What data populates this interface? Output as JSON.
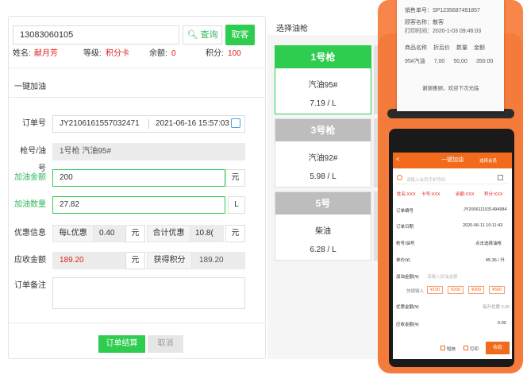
{
  "left": {
    "phone": "13083060105",
    "query_label": "查询",
    "cancel_label": "取客",
    "name_label": "姓名:",
    "name_value": "献月芳",
    "level_label": "等级:",
    "level_value": "积分卡",
    "balance_label": "余额:",
    "balance_value": "0",
    "points_label": "积分:",
    "points_value": "100",
    "section_title": "一键加油",
    "order_label": "订单号",
    "order_value": "JY2106161557032471",
    "order_time": "2021-06-16 15:57:03",
    "nozzle_label": "枪号/油号",
    "nozzle_value": "1号枪  汽油95#",
    "amount_label": "加油金额",
    "amount_value": "200",
    "amount_unit": "元",
    "qty_label": "加油数量",
    "qty_value": "27.82",
    "qty_unit": "L",
    "discount_label": "优惠信息",
    "per_l_label": "每L优惠",
    "per_l_value": "0.40",
    "per_l_unit": "元",
    "total_disc_label": "合计优惠",
    "total_disc_value": "10.8(",
    "total_disc_unit": "元",
    "receivable_label": "应收金额",
    "receivable_value": "189.20",
    "receivable_unit": "元",
    "earn_points_label": "获得积分",
    "earn_points_value": "189.20",
    "remark_label": "订单备注",
    "settle_label": "订单结算",
    "cancel2_label": "取消"
  },
  "mid": {
    "title": "选择油枪",
    "nozzles": [
      {
        "name": "1号枪",
        "fuel": "汽油95#",
        "price": "7.19 / L"
      },
      {
        "name": "3号枪",
        "fuel": "汽油92#",
        "price": "5.98 / L"
      },
      {
        "name": "5号",
        "fuel": "柴油",
        "price": "6.28 / L"
      }
    ]
  },
  "receipt": {
    "line1": "销售单号：SP1235687491857",
    "line2": "顾客名称：散客",
    "line3": "打印时间：2020-1-03  09:46:03",
    "header": [
      "商品名称",
      "折后价",
      "数量",
      "金额"
    ],
    "row": [
      "95#汽油",
      "7,00",
      "50,00",
      "350.00"
    ],
    "footer": "谢谢惠顾，欢迎下次光临"
  },
  "app": {
    "title": "一键加油",
    "member": "选择会员",
    "search_placeholder": "请输入会员手机号码",
    "info": [
      "姓名:XXX",
      "卡号:XXX",
      "余额:XXX",
      "积分:XXX"
    ],
    "rows": [
      {
        "label": "订单编号",
        "value": "JY2006111031494984"
      },
      {
        "label": "订单日期",
        "value": "2020-06-11 10:11:43"
      },
      {
        "label": "枪号/油号",
        "value": "点击选择油枪"
      },
      {
        "label": "单价(¥)",
        "value": "¥5.36 / 升"
      },
      {
        "label": "加油金额(¥)",
        "value": "请输入加油金额"
      },
      {
        "label": "快捷输入",
        "value": ""
      },
      {
        "label": "优惠金额(¥)",
        "value": "每升优惠 0.00"
      },
      {
        "label": "应收金额(¥)",
        "value": "0.00"
      }
    ],
    "quick": [
      "¥100",
      "¥200",
      "¥300",
      "¥500"
    ],
    "print_label": "打印",
    "chk_label": "短信",
    "submit_label": "收款"
  }
}
